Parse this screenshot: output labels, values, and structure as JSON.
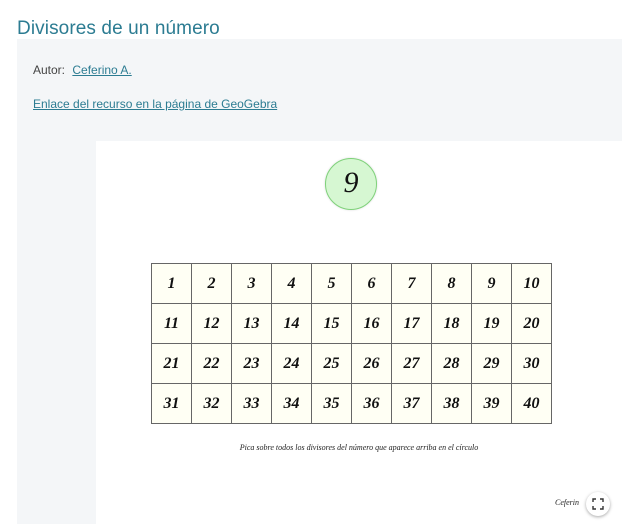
{
  "page": {
    "title": "Divisores de un número"
  },
  "author": {
    "label": "Autor:",
    "name": "Ceferino A."
  },
  "resource_link": "Enlace del recurso en la página de GeoGebra",
  "applet": {
    "target_number": "9",
    "grid": [
      [
        "1",
        "2",
        "3",
        "4",
        "5",
        "6",
        "7",
        "8",
        "9",
        "10"
      ],
      [
        "11",
        "12",
        "13",
        "14",
        "15",
        "16",
        "17",
        "18",
        "19",
        "20"
      ],
      [
        "21",
        "22",
        "23",
        "24",
        "25",
        "26",
        "27",
        "28",
        "29",
        "30"
      ],
      [
        "31",
        "32",
        "33",
        "34",
        "35",
        "36",
        "37",
        "38",
        "39",
        "40"
      ]
    ],
    "instruction": "Pica sobre todos los divisores del número que aparece arriba en el círculo",
    "signature": "Ceferino A."
  },
  "colors": {
    "title": "#2c7c92",
    "link": "#2c7c92",
    "panel": "#f4f6f8",
    "circle_fill": "#d6f7d2",
    "circle_border": "#7fd27a",
    "grid_fill": "#fffff4"
  },
  "icons": {
    "fullscreen": "fullscreen-icon"
  }
}
